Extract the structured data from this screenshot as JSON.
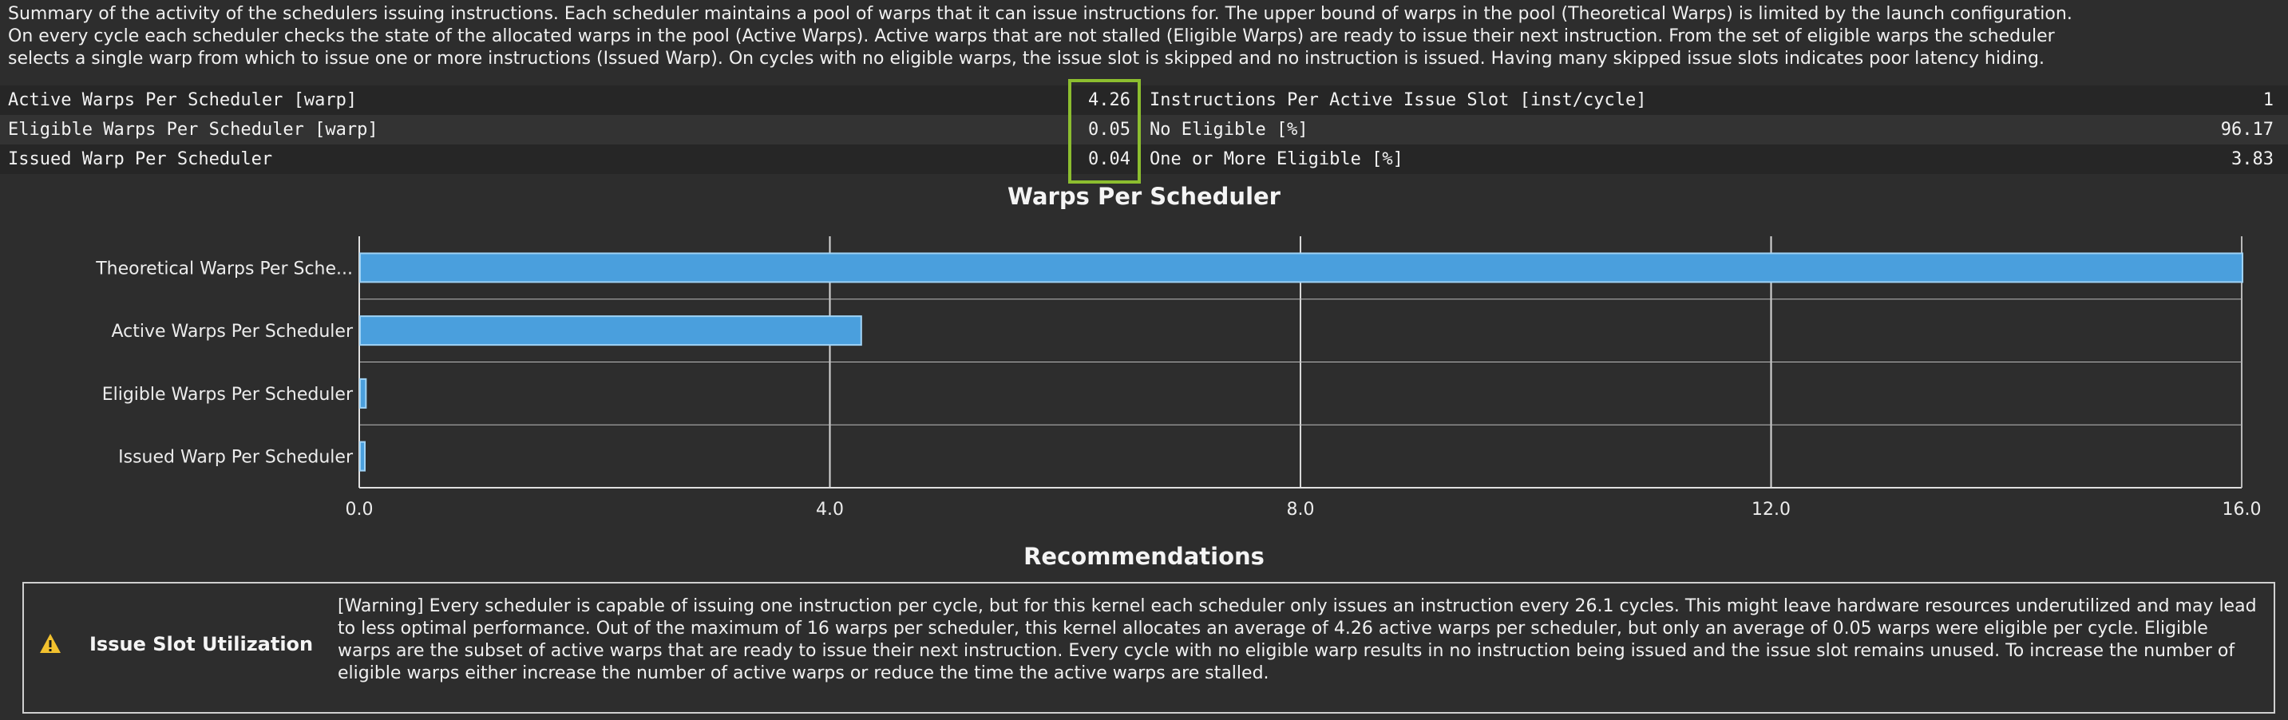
{
  "summary": {
    "text": "Summary of the activity of the schedulers issuing instructions. Each scheduler maintains a pool of warps that it can issue instructions for. The upper bound of warps in the pool (Theoretical Warps) is limited by the launch configuration.\nOn every cycle each scheduler checks the state of the allocated warps in the pool (Active Warps). Active warps that are not stalled (Eligible Warps) are ready to issue their next instruction. From the set of eligible warps the scheduler\nselects a single warp from which to issue one or more instructions (Issued Warp). On cycles with no eligible warps, the issue slot is skipped and no instruction is issued. Having many skipped issue slots indicates poor latency hiding."
  },
  "metrics": [
    {
      "left_name": "Active Warps Per Scheduler [warp]",
      "left_value": "4.26",
      "right_name": "Instructions Per Active Issue Slot [inst/cycle]",
      "right_value": "1"
    },
    {
      "left_name": "Eligible Warps Per Scheduler [warp]",
      "left_value": "0.05",
      "right_name": "No Eligible [%]",
      "right_value": "96.17"
    },
    {
      "left_name": "Issued Warp Per Scheduler",
      "left_value": "0.04",
      "right_name": "One or More Eligible [%]",
      "right_value": "3.83"
    }
  ],
  "highlight_color": "#8cbe2f",
  "chart": {
    "title": "Warps Per Scheduler"
  },
  "chart_data": {
    "type": "bar",
    "orientation": "horizontal",
    "title": "Warps Per Scheduler",
    "xlabel": "",
    "ylabel": "",
    "categories": [
      "Theoretical Warps Per Sche...",
      "Active Warps Per Scheduler",
      "Eligible Warps Per Scheduler",
      "Issued Warp Per Scheduler"
    ],
    "values": [
      16,
      4.26,
      0.05,
      0.04
    ],
    "xlim": [
      0,
      16
    ],
    "xticks": [
      "0.0",
      "4.0",
      "8.0",
      "12.0",
      "16.0"
    ],
    "grid": true,
    "bar_color": "#4a9fdd",
    "bar_border_color": "#9fd2f5"
  },
  "recommendations": {
    "title": "Recommendations",
    "items": [
      {
        "icon": "warning-icon",
        "icon_color": "#f2c12e",
        "name": "Issue Slot Utilization",
        "text": "[Warning] Every scheduler is capable of issuing one instruction per cycle, but for this kernel each scheduler only issues an instruction every 26.1 cycles. This might leave hardware resources underutilized and may lead to less optimal performance. Out of the maximum of 16 warps per scheduler, this kernel allocates an average of 4.26 active warps per scheduler, but only an average of 0.05 warps were eligible per cycle. Eligible warps are the subset of active warps that are ready to issue their next instruction. Every cycle with no eligible warp results in no instruction being issued and the issue slot remains unused. To increase the number of eligible warps either increase the number of active warps or reduce the time the active warps are stalled."
      }
    ]
  }
}
